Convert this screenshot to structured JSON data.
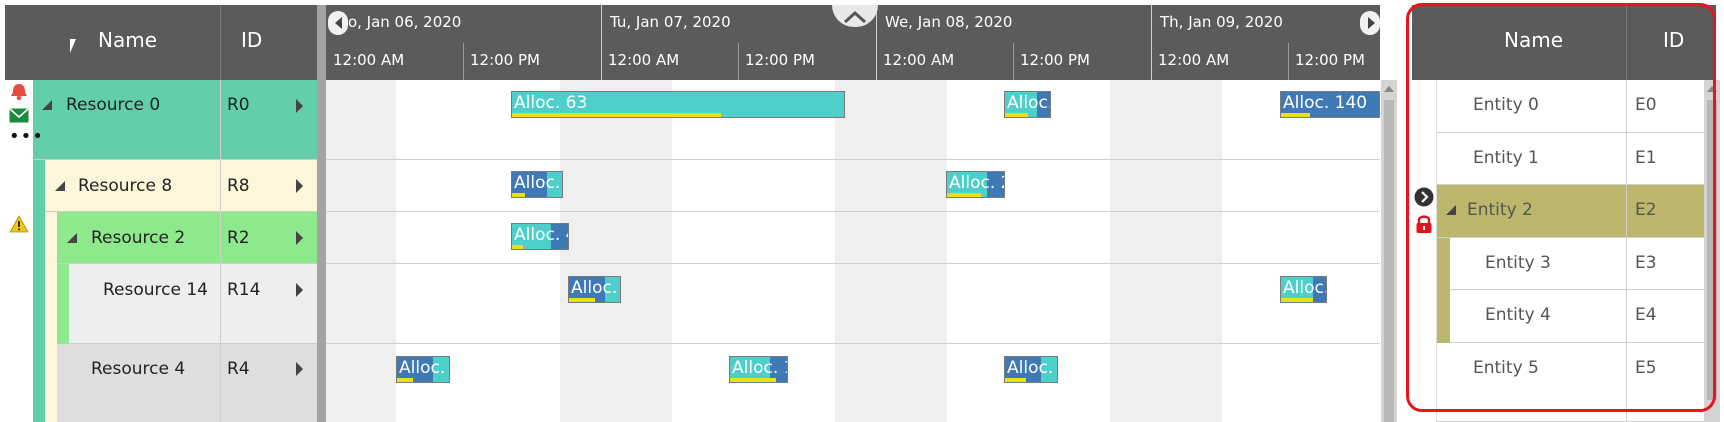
{
  "left_grid": {
    "columns": {
      "name": "Name",
      "id": "ID"
    },
    "rows": [
      {
        "name": "Resource 0",
        "id": "R0"
      },
      {
        "name": "Resource 8",
        "id": "R8"
      },
      {
        "name": "Resource 2",
        "id": "R2"
      },
      {
        "name": "Resource 14",
        "id": "R14"
      },
      {
        "name": "Resource 4",
        "id": "R4"
      }
    ]
  },
  "timeline": {
    "days": [
      "Mo, Jan 06, 2020",
      "Tu, Jan 07, 2020",
      "We, Jan 08, 2020",
      "Th, Jan 09, 2020"
    ],
    "hours": [
      "12:00 AM",
      "12:00 PM",
      "12:00 AM",
      "12:00 PM",
      "12:00 AM",
      "12:00 PM",
      "12:00 AM",
      "12:00 PM"
    ]
  },
  "allocations": [
    {
      "label": "Alloc. 63",
      "row": 0,
      "progress": 0.63,
      "color": "#4ecfcb"
    },
    {
      "label": "Alloc.",
      "row": 0,
      "progress": 0.5,
      "color": "#4ecfcb"
    },
    {
      "label": "Alloc. 140",
      "row": 0,
      "progress": 0.3,
      "color": "#3f79b6"
    },
    {
      "label": "Alloc.",
      "row": 1,
      "progress": 0.25,
      "color": "#3f79b6"
    },
    {
      "label": "Alloc. 2",
      "row": 1,
      "progress": 0.6,
      "color": "#4ecfcb"
    },
    {
      "label": "Alloc. 4",
      "row": 2,
      "progress": 0.2,
      "color": "#4ecfcb"
    },
    {
      "label": "Alloc.",
      "row": 3,
      "progress": 0.5,
      "color": "#3f79b6"
    },
    {
      "label": "Alloc.",
      "row": 3,
      "progress": 0.7,
      "color": "#4ecfcb"
    },
    {
      "label": "Alloc.",
      "row": 4,
      "progress": 0.3,
      "color": "#3f79b6"
    },
    {
      "label": "Alloc. 1",
      "row": 4,
      "progress": 0.8,
      "color": "#4ecfcb"
    },
    {
      "label": "Alloc.",
      "row": 4,
      "progress": 0.4,
      "color": "#3f79b6"
    }
  ],
  "right_grid": {
    "columns": {
      "name": "Name",
      "id": "ID"
    },
    "rows": [
      {
        "name": "Entity 0",
        "id": "E0"
      },
      {
        "name": "Entity 1",
        "id": "E1"
      },
      {
        "name": "Entity 2",
        "id": "E2"
      },
      {
        "name": "Entity 3",
        "id": "E3"
      },
      {
        "name": "Entity 4",
        "id": "E4"
      },
      {
        "name": "Entity 5",
        "id": "E5"
      }
    ]
  },
  "colors": {
    "header": "#5b5b5b",
    "r0": "#63cfa8",
    "r8": "#fdf6da",
    "r2": "#8ee98c",
    "r14": "#eeeeee",
    "r4": "#dedede",
    "selected_entity": "#bdb76b",
    "highlight_border": "#e8141e"
  }
}
